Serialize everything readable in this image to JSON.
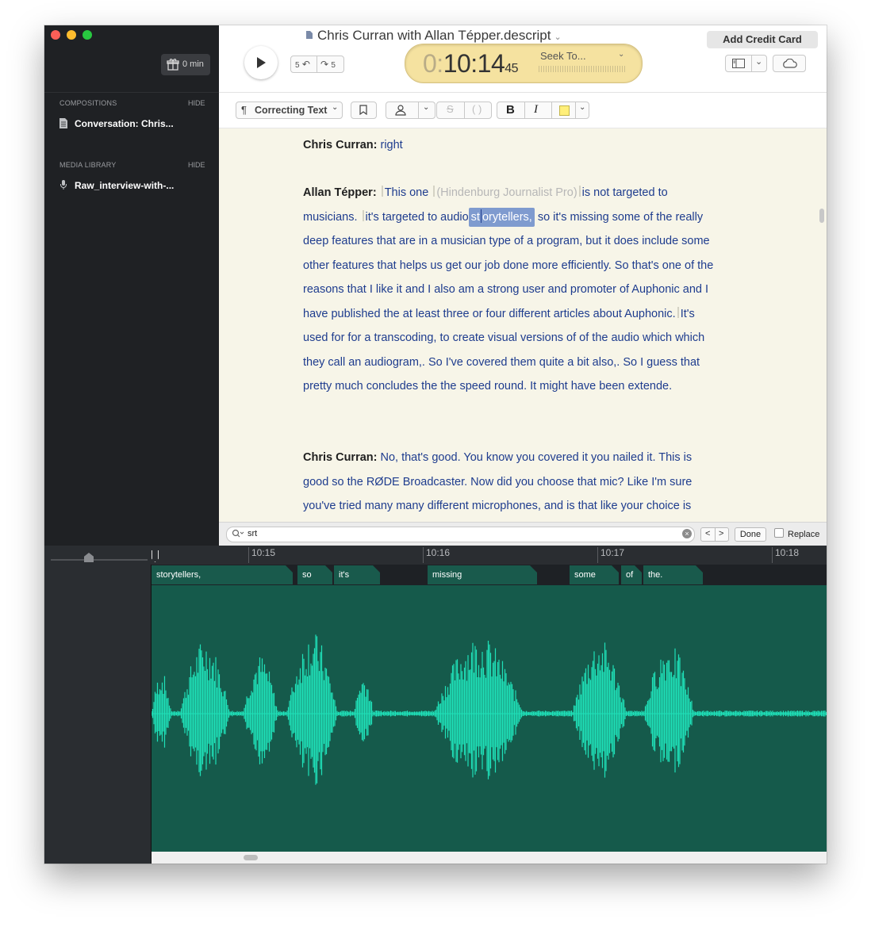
{
  "window": {
    "title": "Chris Curran with Allan Tépper.descript"
  },
  "sidebar": {
    "gift_label": "0 min",
    "sections": [
      {
        "header": "COMPOSITIONS",
        "hide_label": "HIDE",
        "item": "Conversation: Chris..."
      },
      {
        "header": "MEDIA LIBRARY",
        "hide_label": "HIDE",
        "item": "Raw_interview-with-..."
      }
    ]
  },
  "header": {
    "skip_back": "5",
    "skip_forward": "5",
    "timecode": {
      "leading": "0:",
      "main": "10:14",
      "frames": "45"
    },
    "seek_label": "Seek To...",
    "add_credit_label": "Add Credit Card"
  },
  "toolbar": {
    "mode_label": "Correcting Text",
    "bold_label": "B",
    "italic_label": "I"
  },
  "transcript": [
    {
      "speaker": "Chris Curran:",
      "text": "right"
    },
    {
      "speaker": "Allan Tépper:",
      "t1": "This one",
      "t2": "(Hindenburg Journalist Pro)",
      "t3": "is not targeted to musicians.",
      "t4": "it's targeted to audio",
      "hl_a": "st",
      "hl_b": "orytellers,",
      "t5": "so it's missing some of the really deep features that are in a musician type of a program, but it does include some other features that helps us get our job done more efficiently. So that's one of the reasons that I like it and I also am a strong user and promoter of Auphonic and I have published the at least three or four different articles about Auphonic.",
      "t6": "It's used for for a transcoding, to create visual versions of of the audio which which they call an audiogram,. So I've covered them quite a bit also,. So I guess that pretty much concludes the the speed round. It might have been extende."
    },
    {
      "speaker": "Chris Curran:",
      "text": "No, that's good. You know you covered it you nailed it. This is good so the RØDE Broadcaster. Now did you choose that mic? Like I'm sure you've tried many many different microphones, and is that like your choice is"
    }
  ],
  "find_bar": {
    "query": "srt",
    "prev": "<",
    "next": ">",
    "done_label": "Done",
    "replace_label": "Replace",
    "replace_checked": false
  },
  "timeline": {
    "ruler_labels": [
      "10:15",
      "10:16",
      "10:17",
      "10:18"
    ],
    "words": [
      "storytellers,",
      "so",
      "it's",
      "missing",
      "some",
      "of",
      "the."
    ],
    "colors": {
      "track": "#155a4b",
      "wave": "#1fe0b8",
      "word_block": "#195a4c"
    }
  }
}
